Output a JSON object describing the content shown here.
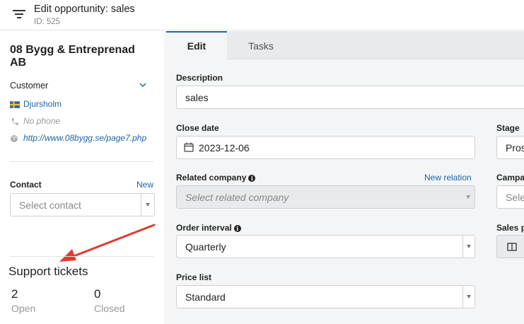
{
  "header": {
    "title": "Edit opportunity: sales",
    "id_text": "ID: 525"
  },
  "sidebar": {
    "company_name": "08 Bygg & Entreprenad AB",
    "customer_label": "Customer",
    "city": "Djursholm",
    "phone": "No phone",
    "website": "http://www.08bygg.se/page7.php",
    "contact": {
      "label": "Contact",
      "new_label": "New",
      "placeholder": "Select contact"
    },
    "tickets": {
      "title": "Support tickets",
      "open_count": "2",
      "open_label": "Open",
      "closed_count": "0",
      "closed_label": "Closed"
    }
  },
  "tabs": [
    {
      "label": "Edit",
      "active": true
    },
    {
      "label": "Tasks",
      "active": false
    }
  ],
  "form": {
    "description": {
      "label": "Description",
      "value": "sales"
    },
    "close_date": {
      "label": "Close date",
      "value": "2023-12-06"
    },
    "stage": {
      "label": "Stage",
      "value": "Pros"
    },
    "related_company": {
      "label": "Related company",
      "link": "New relation",
      "placeholder": "Select related company"
    },
    "campaign": {
      "label": "Campa",
      "placeholder": "Sele"
    },
    "order_interval": {
      "label": "Order interval",
      "value": "Quarterly"
    },
    "sales_p": {
      "label": "Sales p"
    },
    "price_list": {
      "label": "Price list",
      "value": "Standard"
    }
  },
  "colors": {
    "accent": "#1e63a8",
    "annotation_arrow": "#e03c31",
    "flag_blue": "#2f66b3",
    "flag_yellow": "#f5c518"
  },
  "icons": {
    "filter": "filter-icon",
    "chevron": "chevron-down-icon",
    "flag": "sweden-flag-icon",
    "phone": "phone-icon",
    "globe": "globe-icon",
    "info": "info-icon",
    "calendar": "calendar-icon",
    "columns": "columns-icon"
  }
}
